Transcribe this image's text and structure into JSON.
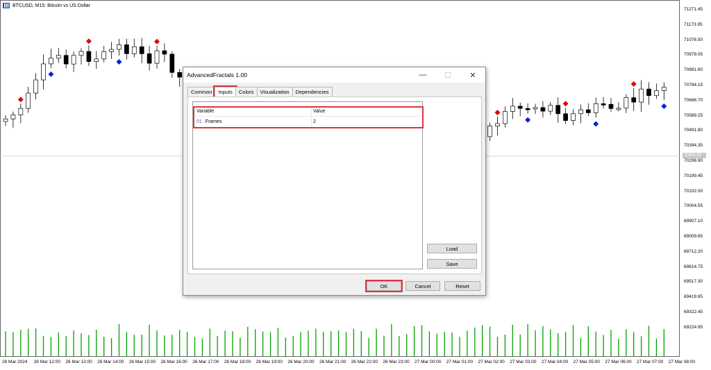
{
  "chart": {
    "symbol_title": "BTCUSD, M15: Bitcoin vs US Dollar",
    "current_price": "70394.35",
    "price_axis": [
      "71271.45",
      "71173.95",
      "71076.50",
      "70979.05",
      "70881.60",
      "70784.15",
      "70686.70",
      "70589.25",
      "70491.80",
      "70394.35",
      "70296.90",
      "70199.45",
      "70102.00",
      "70004.55",
      "69907.10",
      "69009.65",
      "69712.20",
      "69614.75",
      "69517.30",
      "69419.85",
      "69322.45",
      "69224.95"
    ],
    "time_axis": [
      "26 Mar 2024",
      "26 Mar 12:00",
      "26 Mar 13:00",
      "26 Mar 14:00",
      "26 Mar 15:00",
      "26 Mar 16:00",
      "26 Mar 17:00",
      "26 Mar 18:00",
      "26 Mar 19:00",
      "26 Mar 20:00",
      "26 Mar 21:00",
      "26 Mar 22:00",
      "26 Mar 23:00",
      "27 Mar 00:00",
      "27 Mar 01:00",
      "27 Mar 02:00",
      "27 Mar 03:00",
      "27 Mar 04:00",
      "27 Mar 05:00",
      "27 Mar 06:00",
      "27 Mar 07:00",
      "27 Mar 08:00"
    ],
    "colors": {
      "bull": "#ffffff",
      "bear": "#000000",
      "volume": "#00a000",
      "fractal_up": "#e60000",
      "fractal_down": "#0a1fe0",
      "grid": "#c8c8c8"
    }
  },
  "dialog": {
    "title": "AdvancedFractals 1.00",
    "tabs": [
      "Common",
      "Inputs",
      "Colors",
      "Visualization",
      "Dependencies"
    ],
    "active_tab": "Inputs",
    "table": {
      "headers": [
        "Variable",
        "Value"
      ],
      "rows": [
        {
          "index": "01",
          "variable": "Frames",
          "value": "2"
        }
      ]
    },
    "buttons": {
      "load": "Load",
      "save": "Save",
      "ok": "OK",
      "cancel": "Cancel",
      "reset": "Reset"
    }
  }
}
